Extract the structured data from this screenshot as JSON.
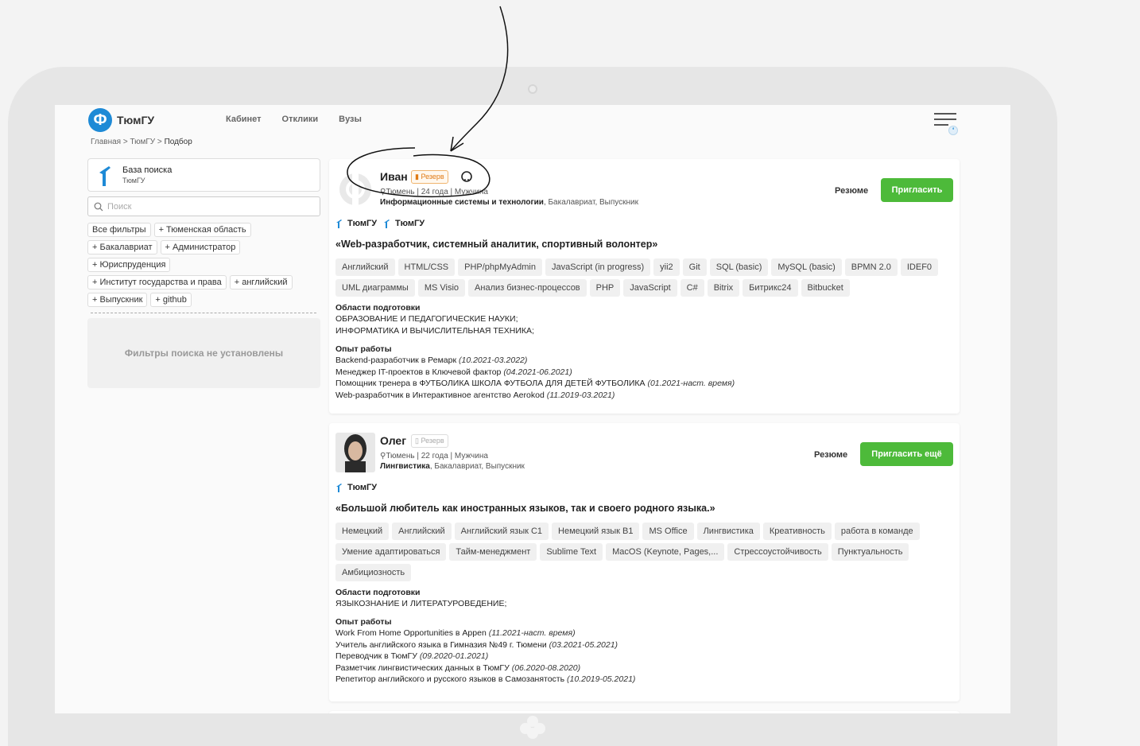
{
  "header": {
    "logo_letter": "Ф",
    "logo_text": "ТюмГУ",
    "nav": [
      "Кабинет",
      "Отклики",
      "Вузы"
    ],
    "breadcrumb": {
      "part1": "Главная > ТюмГУ > ",
      "current": "Подбор"
    }
  },
  "sidebar": {
    "base_title": "База поиска",
    "base_subtitle": "ТюмГУ",
    "search_placeholder": "Поиск",
    "filter_rows": [
      [
        "Все фильтры",
        "+ Тюменская область"
      ],
      [
        "+ Бакалавриат",
        "+ Администратор"
      ],
      [
        "+ Юриспруденция"
      ],
      [
        "+ Институт государства и права",
        "+ английский"
      ],
      [
        "+ Выпускник",
        "+ github"
      ]
    ],
    "no_filters": "Фильтры поиска не установлены"
  },
  "candidates": [
    {
      "name": "Иван",
      "reserve": "Резерв",
      "meta": "Тюмень | 24 года | Мужчина",
      "edu_bold": "Информационные системы и технологии",
      "edu_rest": ", Бакалавриат, Выпускник",
      "universities": [
        "ТюмГУ",
        "ТюмГУ"
      ],
      "resume_label": "Резюме",
      "invite_label": "Пригласить",
      "quote": "«Web-разработчик, системный аналитик, спортивный волонтер»",
      "skills": [
        "Английский",
        "HTML/CSS",
        "PHP/phpMyAdmin",
        "JavaScript (in progress)",
        "yii2",
        "Git",
        "SQL (basic)",
        "MySQL (basic)",
        "BPMN 2.0",
        "IDEF0",
        "UML диаграммы",
        "MS Visio",
        "Анализ бизнес-процессов",
        "PHP",
        "JavaScript",
        "C#",
        "Bitrix",
        "Битрикс24",
        "Bitbucket"
      ],
      "areas_title": "Области подготовки",
      "areas": [
        "ОБРАЗОВАНИЕ И ПЕДАГОГИЧЕСКИЕ НАУКИ;",
        "ИНФОРМАТИКА И ВЫЧИСЛИТЕЛЬНАЯ ТЕХНИКА;"
      ],
      "experience_title": "Опыт работы",
      "experience": [
        {
          "text": "Backend-разработчик в Ремарк ",
          "period": "(10.2021-03.2022)"
        },
        {
          "text": "Менеджер IT-проектов в Ключевой фактор ",
          "period": "(04.2021-06.2021)"
        },
        {
          "text": "Помощник тренера в ФУТБОЛИКА ШКОЛА ФУТБОЛА ДЛЯ ДЕТЕЙ ФУТБОЛИКА ",
          "period": "(01.2021-наст. время)"
        },
        {
          "text": "Web-разработчик в Интерактивное агентство Aerokod ",
          "period": "(11.2019-03.2021)"
        }
      ]
    },
    {
      "name": "Олег",
      "reserve": "Резерв",
      "meta": "Тюмень | 22 года | Мужчина",
      "edu_bold": "Лингвистика",
      "edu_rest": ", Бакалавриат, Выпускник",
      "universities": [
        "ТюмГУ"
      ],
      "resume_label": "Резюме",
      "invite_label": "Пригласить ещё",
      "quote": "«Большой любитель как иностранных языков, так и своего родного языка.»",
      "skills": [
        "Немецкий",
        "Английский",
        "Английский язык С1",
        "Немецкий язык В1",
        "MS Office",
        "Лингвистика",
        "Креативность",
        "работа в команде",
        "Умение адаптироваться",
        "Тайм-менеджмент",
        "Sublime Text",
        "MacOS (Keynote, Pages,...",
        "Стрессоустойчивость",
        "Пунктуальность",
        "Амбициозность"
      ],
      "areas_title": "Области подготовки",
      "areas": [
        "ЯЗЫКОЗНАНИЕ И ЛИТЕРАТУРОВЕДЕНИЕ;"
      ],
      "experience_title": "Опыт работы",
      "experience": [
        {
          "text": "Work From Home Opportunities в Appen ",
          "period": "(11.2021-наст. время)"
        },
        {
          "text": "Учитель английского языка в Гимназия №49 г. Тюмени ",
          "period": "(03.2021-05.2021)"
        },
        {
          "text": "Переводчик в ТюмГУ ",
          "period": "(09.2020-01.2021)"
        },
        {
          "text": "Разметчик лингвистических данных в ТюмГУ ",
          "period": "(06.2020-08.2020)"
        },
        {
          "text": "Репетитор английского и русского языков в Самозанятость ",
          "period": "(10.2019-05.2021)"
        }
      ]
    }
  ],
  "colors": {
    "brand": "#1e8ad6",
    "accent_green": "#4dba3a",
    "reserve_orange": "#e07a14"
  },
  "icons": [
    "logo-icon",
    "menu-icon",
    "search-icon",
    "location-icon",
    "bookmark-icon",
    "github-icon",
    "university-icon"
  ]
}
